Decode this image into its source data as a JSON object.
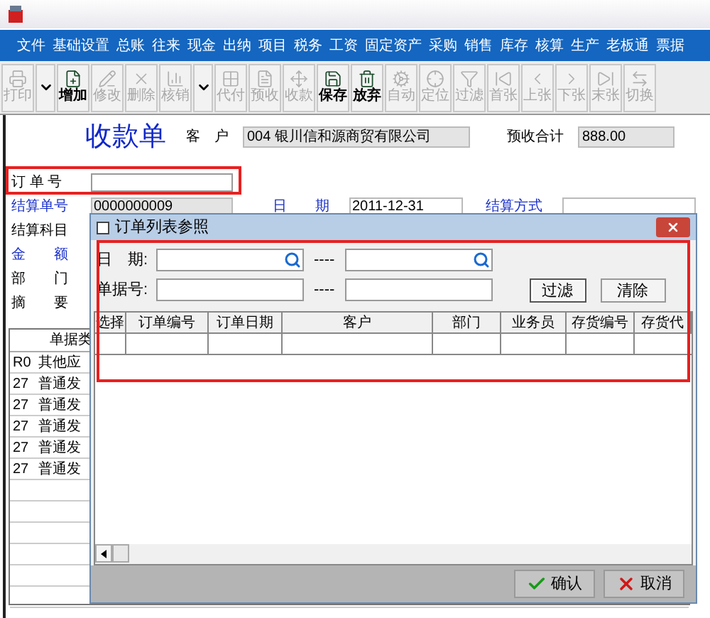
{
  "menu": [
    "文件",
    "基础设置",
    "总账",
    "往来",
    "现金",
    "出纳",
    "项目",
    "税务",
    "工资",
    "固定资产",
    "采购",
    "销售",
    "库存",
    "核算",
    "生产",
    "老板通",
    "票据"
  ],
  "toolbar": [
    {
      "kind": "button",
      "label": "打印",
      "disabled": true
    },
    {
      "kind": "dropdown",
      "disabled": false
    },
    {
      "kind": "button",
      "label": "增加",
      "disabled": false
    },
    {
      "kind": "button",
      "label": "修改",
      "disabled": true
    },
    {
      "kind": "button",
      "label": "删除",
      "disabled": true
    },
    {
      "kind": "button",
      "label": "核销",
      "disabled": true
    },
    {
      "kind": "dropdown",
      "disabled": false
    },
    {
      "kind": "button",
      "label": "代付",
      "disabled": true
    },
    {
      "kind": "button",
      "label": "预收",
      "disabled": true
    },
    {
      "kind": "button",
      "label": "收款",
      "disabled": true
    },
    {
      "kind": "button",
      "label": "保存",
      "disabled": false
    },
    {
      "kind": "button",
      "label": "放弃",
      "disabled": false
    },
    {
      "kind": "button",
      "label": "自动",
      "disabled": true
    },
    {
      "kind": "button",
      "label": "定位",
      "disabled": true
    },
    {
      "kind": "button",
      "label": "过滤",
      "disabled": true
    },
    {
      "kind": "button",
      "label": "首张",
      "disabled": true
    },
    {
      "kind": "button",
      "label": "上张",
      "disabled": true
    },
    {
      "kind": "button",
      "label": "下张",
      "disabled": true
    },
    {
      "kind": "button",
      "label": "末张",
      "disabled": true
    },
    {
      "kind": "button",
      "label": "切换",
      "disabled": true
    }
  ],
  "form": {
    "title": "收款单",
    "customer_label": "客　户",
    "customer_value": "004  银川信和源商贸有限公司",
    "prepaid_label": "预收合计",
    "prepaid_value": "888.00",
    "order_no_label": "订 单 号",
    "settle_no_label": "结算单号",
    "settle_no_value": "0000000009",
    "date_label": "日　　期",
    "date_value": "2011-12-31",
    "settle_method_label": "结算方式",
    "labels": [
      {
        "text": "结算科目",
        "blue": false
      },
      {
        "text": "金　　额",
        "blue": true
      },
      {
        "text": "部　　门",
        "blue": false
      },
      {
        "text": "摘　　要",
        "blue": false
      }
    ]
  },
  "bg_table": {
    "header": "单据类",
    "rows": [
      {
        "code": "R0",
        "type": "其他应"
      },
      {
        "code": "27",
        "type": "普通发"
      },
      {
        "code": "27",
        "type": "普通发"
      },
      {
        "code": "27",
        "type": "普通发"
      },
      {
        "code": "27",
        "type": "普通发"
      },
      {
        "code": "27",
        "type": "普通发"
      }
    ]
  },
  "dialog": {
    "title": "订单列表参照",
    "date_label": "日　期:",
    "bill_label": "单据号:",
    "separator": "----",
    "filter_button": "过滤",
    "clear_button": "清除",
    "columns": [
      "选择",
      "订单编号",
      "订单日期",
      "客户",
      "部门",
      "业务员",
      "存货编号",
      "存货代"
    ],
    "ok_button": "确认",
    "cancel_button": "取消"
  }
}
